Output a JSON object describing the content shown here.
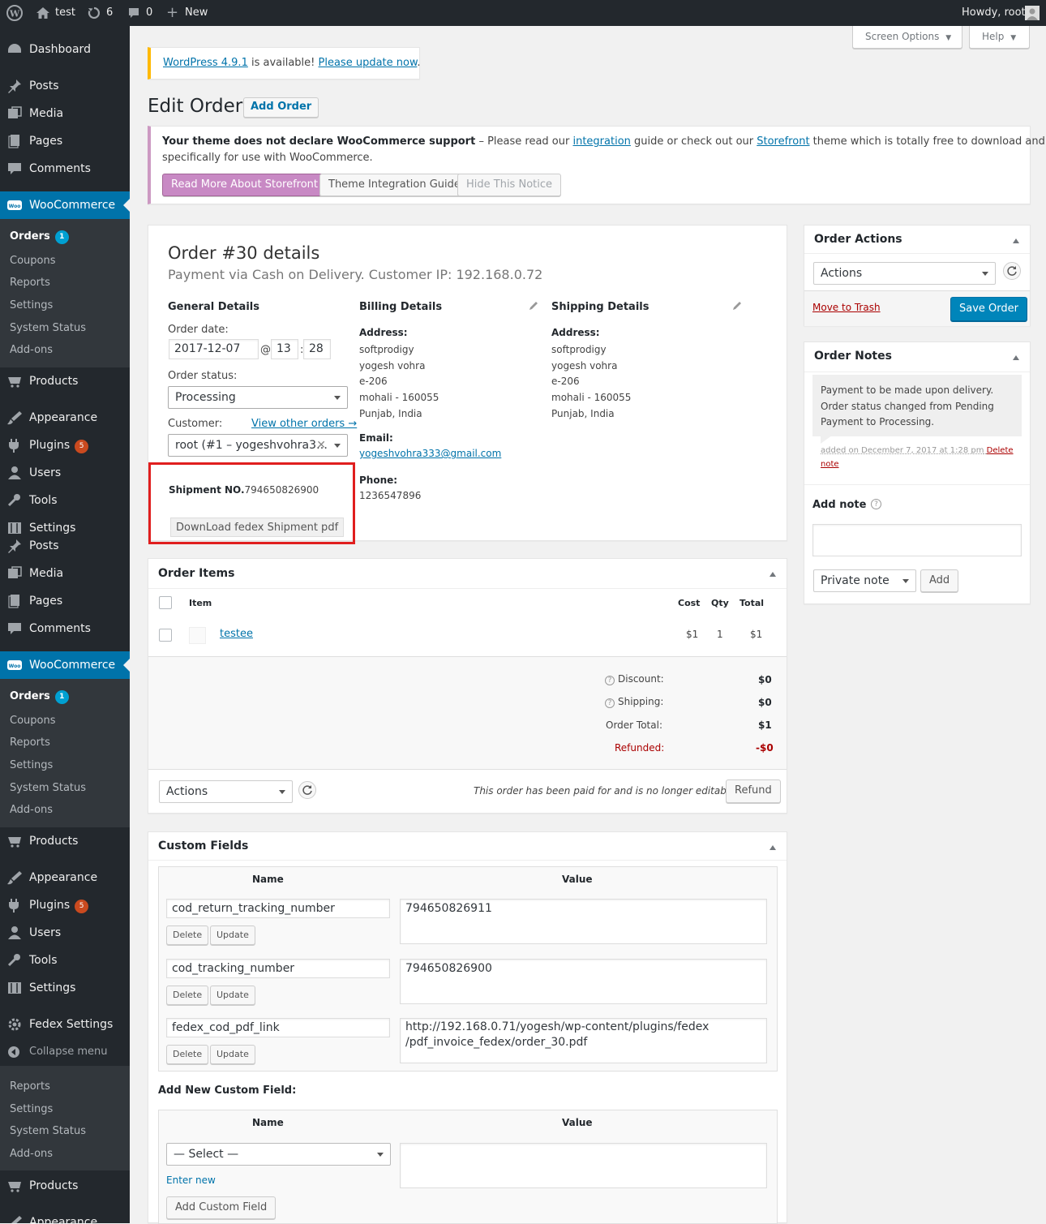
{
  "adminbar": {
    "site_name": "test",
    "updates_count": "6",
    "comments_count": "0",
    "new_label": "New",
    "howdy": "Howdy, root"
  },
  "screen_meta": {
    "screen_options": "Screen Options",
    "help": "Help"
  },
  "update_notice": {
    "version_link": "WordPress 4.9.1",
    "middle": " is available! ",
    "update_link": "Please update now",
    "end": "."
  },
  "page": {
    "title": "Edit Order",
    "add_button": "Add Order"
  },
  "theme_notice": {
    "bold": "Your theme does not declare WooCommerce support",
    "text1": " – Please read our ",
    "link1": "integration",
    "text2": " guide or check out our ",
    "link2": "Storefront",
    "text3": " theme which is totally free to download and designed",
    "line2": "specifically for use with WooCommerce.",
    "btn_storefront": "Read More About Storefront",
    "btn_guide": "Theme Integration Guide",
    "btn_hide": "Hide This Notice"
  },
  "sidebar": {
    "dashboard": "Dashboard",
    "posts": "Posts",
    "media": "Media",
    "pages": "Pages",
    "comments": "Comments",
    "woocommerce": "WooCommerce",
    "orders": "Orders",
    "orders_count": "1",
    "coupons": "Coupons",
    "reports": "Reports",
    "settings": "Settings",
    "system_status": "System Status",
    "addons": "Add-ons",
    "products": "Products",
    "appearance": "Appearance",
    "plugins": "Plugins",
    "plugins_count": "5",
    "users": "Users",
    "tools": "Tools",
    "fedex_settings": "Fedex Settings",
    "collapse": "Collapse menu"
  },
  "order": {
    "heading": "Order #30 details",
    "subheading": "Payment via Cash on Delivery. Customer IP: 192.168.0.72",
    "general_title": "General Details",
    "order_date_label": "Order date:",
    "order_date": "2017-12-07",
    "at": "@",
    "hour": "13",
    "colon": ":",
    "minute": "28",
    "status_label": "Order status:",
    "status": "Processing",
    "customer_label": "Customer:",
    "view_other": "View other orders →",
    "customer": "root (#1 – yogeshvohra3…",
    "shipment_label": "Shipment NO.",
    "shipment_no": "794650826900",
    "download_btn": "DownLoad fedex Shipment pdf",
    "billing_title": "Billing Details",
    "shipping_title": "Shipping Details",
    "address_label": "Address:",
    "address_lines": [
      "softprodigy",
      "yogesh vohra",
      "e-206",
      "mohali - 160055",
      "Punjab, India"
    ],
    "email_label": "Email:",
    "email": "yogeshvohra333@gmail.com",
    "phone_label": "Phone:",
    "phone": "1236547896"
  },
  "order_items": {
    "title": "Order Items",
    "col_item": "Item",
    "col_cost": "Cost",
    "col_qty": "Qty",
    "col_total": "Total",
    "item_name": "testee",
    "item_cost": "$1",
    "item_qty": "1",
    "item_total": "$1",
    "discount_label": "Discount:",
    "discount": "$0",
    "shipping_label": "Shipping:",
    "shipping": "$0",
    "order_total_label": "Order Total:",
    "order_total": "$1",
    "refunded_label": "Refunded:",
    "refunded": "-$0",
    "actions": "Actions",
    "paid_note": "This order has been paid for and is no longer editable",
    "refund_btn": "Refund"
  },
  "custom_fields": {
    "title": "Custom Fields",
    "col_name": "Name",
    "col_value": "Value",
    "rows": [
      {
        "name": "cod_return_tracking_number",
        "value": "794650826911"
      },
      {
        "name": "cod_tracking_number",
        "value": "794650826900"
      },
      {
        "name": "fedex_cod_pdf_link",
        "value_line1": "http://192.168.0.71/yogesh/wp-content/plugins/fedex",
        "value_line2": "/pdf_invoice_fedex/order_30.pdf"
      }
    ],
    "delete_btn": "Delete",
    "update_btn": "Update",
    "add_new_title": "Add New Custom Field:",
    "select_placeholder": "— Select —",
    "enter_new": "Enter new",
    "add_btn": "Add Custom Field"
  },
  "order_actions": {
    "title": "Order Actions",
    "select": "Actions",
    "trash": "Move to Trash",
    "save": "Save Order"
  },
  "order_notes": {
    "title": "Order Notes",
    "note_line1": "Payment to be made upon delivery.",
    "note_line2": "Order status changed from Pending",
    "note_line3": "Payment to Processing.",
    "meta": "added on December 7, 2017 at 1:28 pm",
    "delete_note1": "Delete",
    "delete_note2": "note",
    "add_note_label": "Add note",
    "note_type": "Private note",
    "add_btn": "Add"
  },
  "colors": {
    "accent": "#0073aa",
    "admin_dark": "#23282d",
    "highlight_red": "#e01e1e",
    "storefront_btn": "#c889c4"
  }
}
